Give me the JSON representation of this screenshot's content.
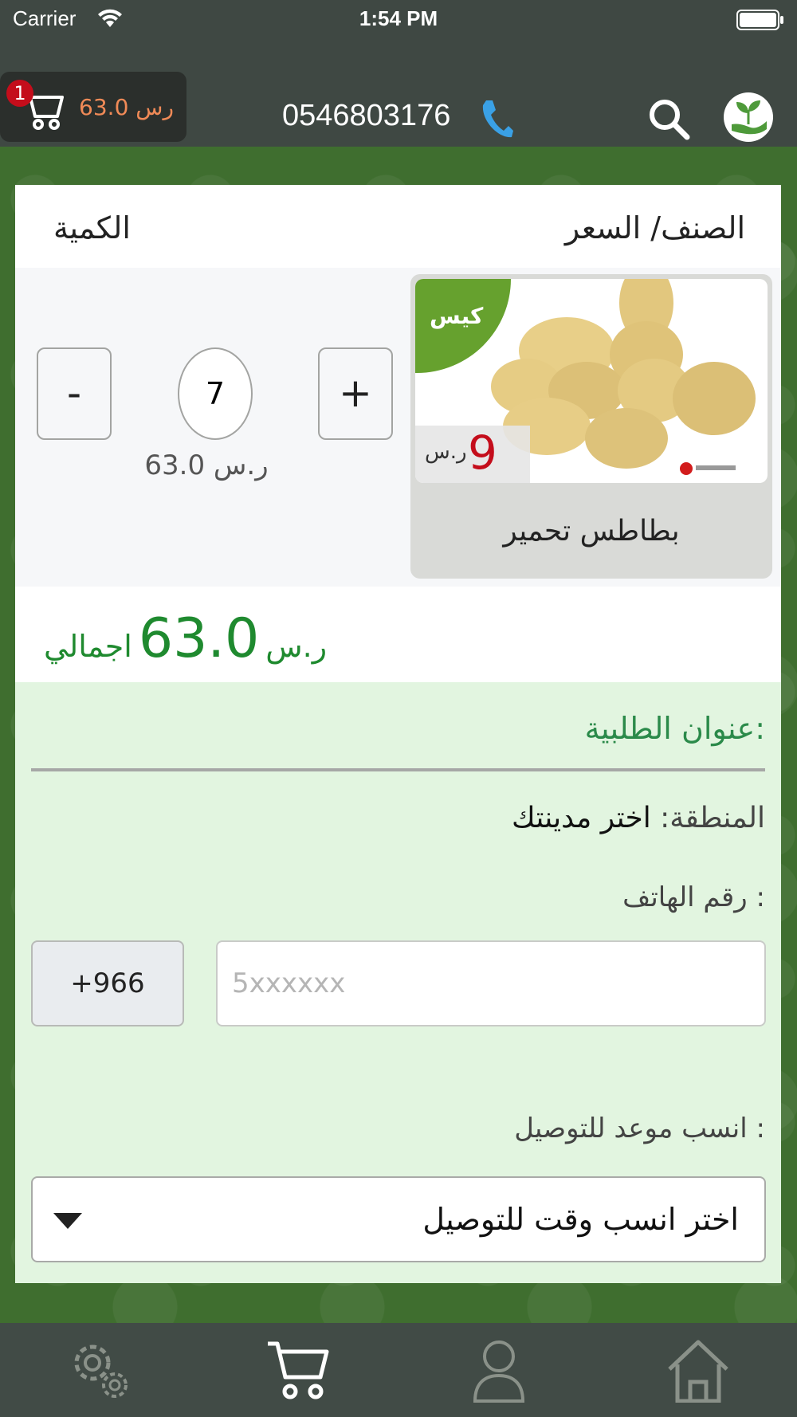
{
  "status_bar": {
    "carrier": "Carrier",
    "time": "1:54 PM"
  },
  "nav": {
    "cart_total": "63.0 رس",
    "cart_count": "1",
    "phone": "0546803176"
  },
  "cart": {
    "header_price": "الصنف/ السعر",
    "header_qty": "الكمية",
    "item": {
      "package": "كيس",
      "unit_price": "9",
      "currency": "ر.س",
      "name": "بطاطس تحمير",
      "quantity": "7",
      "plus": "+",
      "minus": "-",
      "line_total": "63.0 ر.س"
    },
    "total": {
      "label": "اجمالي",
      "amount": "63.0",
      "currency": "ر.س"
    }
  },
  "address": {
    "title": "عنوان الطلبية:",
    "region_label": "المنطقة:",
    "region_value": "اختر مدينتك",
    "phone_label": "رقم الهاتف :",
    "country_code": "+966",
    "phone_placeholder": "5xxxxxx",
    "time_label": "انسب موعد للتوصيل :",
    "time_select": "اختر انسب وقت للتوصيل"
  },
  "tabbar": {
    "icons": [
      "settings-icon",
      "cart-icon",
      "user-icon",
      "home-icon"
    ]
  },
  "colors": {
    "bar": "#3f4843",
    "green_text": "#1f8a2f",
    "price_red": "#c40d1b",
    "package_green": "#66a12e",
    "cart_price": "#f08a57",
    "address_bg": "#e2f5e0"
  }
}
